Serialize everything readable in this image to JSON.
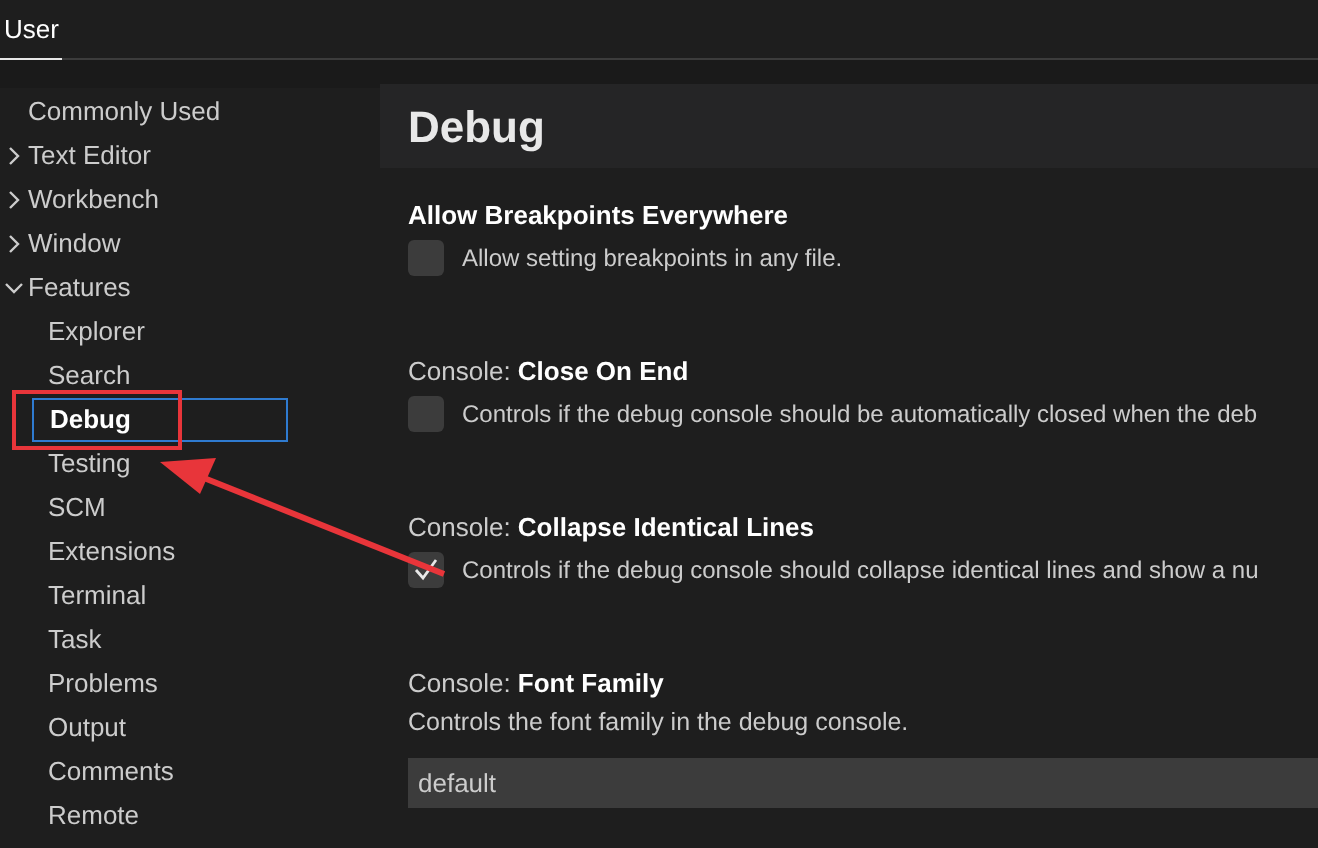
{
  "tabs": [
    {
      "label": "User",
      "selected": true
    }
  ],
  "sidebar": {
    "items": [
      {
        "label": "Commonly Used",
        "selected": false
      },
      {
        "label": "Text Editor",
        "selected": false,
        "expanded": false
      },
      {
        "label": "Workbench",
        "selected": false,
        "expanded": false
      },
      {
        "label": "Window",
        "selected": false,
        "expanded": false
      },
      {
        "label": "Features",
        "selected": false,
        "expanded": true,
        "children": [
          {
            "label": "Explorer",
            "selected": false
          },
          {
            "label": "Search",
            "selected": false
          },
          {
            "label": "Debug",
            "selected": true
          },
          {
            "label": "Testing",
            "selected": false
          },
          {
            "label": "SCM",
            "selected": false
          },
          {
            "label": "Extensions",
            "selected": false
          },
          {
            "label": "Terminal",
            "selected": false
          },
          {
            "label": "Task",
            "selected": false
          },
          {
            "label": "Problems",
            "selected": false
          },
          {
            "label": "Output",
            "selected": false
          },
          {
            "label": "Comments",
            "selected": false
          },
          {
            "label": "Remote",
            "selected": false
          }
        ]
      }
    ]
  },
  "section_title": "Debug",
  "settings": [
    {
      "kind": "checkbox",
      "name": "Allow Breakpoints Everywhere",
      "description": "Allow setting breakpoints in any file.",
      "checked": false
    },
    {
      "kind": "checkbox",
      "category": "Console: ",
      "name": "Close On End",
      "description": "Controls if the debug console should be automatically closed when the deb",
      "checked": false
    },
    {
      "kind": "checkbox",
      "category": "Console: ",
      "name": "Collapse Identical Lines",
      "description": "Controls if the debug console should collapse identical lines and show a nu",
      "checked": true
    },
    {
      "kind": "text",
      "category": "Console: ",
      "name": "Font Family",
      "description": "Controls the font family in the debug console.",
      "value": "default"
    }
  ]
}
